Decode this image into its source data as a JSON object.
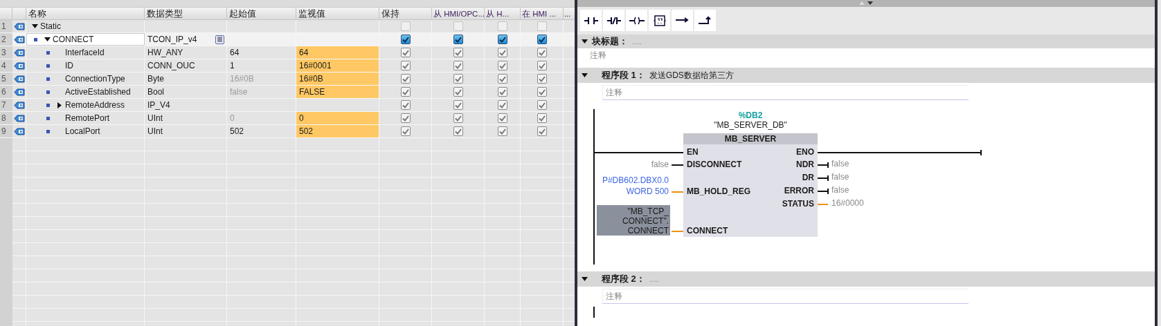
{
  "variable_table": {
    "columns": [
      {
        "label": "名称"
      },
      {
        "label": "数据类型"
      },
      {
        "label": "起始值"
      },
      {
        "label": "监视值"
      },
      {
        "label": "保持"
      },
      {
        "label": "从 HMI/OPC..."
      },
      {
        "label": "从 H..."
      },
      {
        "label": "在 HMI ..."
      },
      {
        "label": "..."
      }
    ],
    "rows": [
      {
        "number": "1",
        "name": "Static",
        "selected": false,
        "expanded": true,
        "flags": [
          {
            "checked": false,
            "disabled": true
          },
          {
            "checked": false,
            "disabled": true
          },
          {
            "checked": false,
            "disabled": true
          },
          {
            "checked": false,
            "disabled": true
          }
        ],
        "children": [
          {
            "number": "2",
            "name": "CONNECT",
            "type": "TCON_IP_v4",
            "selected": true,
            "expanded": true,
            "flags": [
              {
                "checked": true,
                "disabled": false
              },
              {
                "checked": true,
                "disabled": false
              },
              {
                "checked": true,
                "disabled": false
              },
              {
                "checked": true,
                "disabled": false
              }
            ],
            "children": [
              {
                "number": "3",
                "name": "InterfaceId",
                "type": "HW_ANY",
                "start": "64",
                "start_dimmed": false,
                "monitor": "64",
                "selected": false,
                "flags": [
                  {
                    "checked": true,
                    "disabled": true
                  },
                  {
                    "checked": true,
                    "disabled": true
                  },
                  {
                    "checked": true,
                    "disabled": true
                  },
                  {
                    "checked": true,
                    "disabled": true
                  }
                ]
              },
              {
                "number": "4",
                "name": "ID",
                "type": "CONN_OUC",
                "start": "1",
                "start_dimmed": false,
                "monitor": "16#0001",
                "selected": false,
                "flags": [
                  {
                    "checked": true,
                    "disabled": true
                  },
                  {
                    "checked": true,
                    "disabled": true
                  },
                  {
                    "checked": true,
                    "disabled": true
                  },
                  {
                    "checked": true,
                    "disabled": true
                  }
                ]
              },
              {
                "number": "5",
                "name": "ConnectionType",
                "type": "Byte",
                "start": "16#0B",
                "start_dimmed": true,
                "monitor": "16#0B",
                "selected": false,
                "flags": [
                  {
                    "checked": true,
                    "disabled": true
                  },
                  {
                    "checked": true,
                    "disabled": true
                  },
                  {
                    "checked": true,
                    "disabled": true
                  },
                  {
                    "checked": true,
                    "disabled": true
                  }
                ]
              },
              {
                "number": "6",
                "name": "ActiveEstablished",
                "type": "Bool",
                "start": "false",
                "start_dimmed": true,
                "monitor": "FALSE",
                "selected": false,
                "flags": [
                  {
                    "checked": true,
                    "disabled": true
                  },
                  {
                    "checked": true,
                    "disabled": true
                  },
                  {
                    "checked": true,
                    "disabled": true
                  },
                  {
                    "checked": true,
                    "disabled": true
                  }
                ]
              },
              {
                "number": "7",
                "name": "RemoteAddress",
                "type": "IP_V4",
                "selected": false,
                "expanded": false,
                "flags": [
                  {
                    "checked": true,
                    "disabled": true
                  },
                  {
                    "checked": true,
                    "disabled": true
                  },
                  {
                    "checked": true,
                    "disabled": true
                  },
                  {
                    "checked": true,
                    "disabled": true
                  }
                ]
              },
              {
                "number": "8",
                "name": "RemotePort",
                "type": "UInt",
                "start": "0",
                "start_dimmed": true,
                "monitor": "0",
                "selected": false,
                "flags": [
                  {
                    "checked": true,
                    "disabled": true
                  },
                  {
                    "checked": true,
                    "disabled": true
                  },
                  {
                    "checked": true,
                    "disabled": true
                  },
                  {
                    "checked": true,
                    "disabled": true
                  }
                ]
              },
              {
                "number": "9",
                "name": "LocalPort",
                "type": "UInt",
                "start": "502",
                "start_dimmed": false,
                "monitor": "502",
                "selected": false,
                "flags": [
                  {
                    "checked": true,
                    "disabled": true
                  },
                  {
                    "checked": true,
                    "disabled": true
                  },
                  {
                    "checked": true,
                    "disabled": true
                  },
                  {
                    "checked": true,
                    "disabled": true
                  }
                ]
              }
            ]
          }
        ]
      }
    ]
  },
  "editor": {
    "toolbar": [
      {
        "kind": "no_contact"
      },
      {
        "kind": "nc_contact"
      },
      {
        "kind": "coil"
      },
      {
        "kind": "empty_box"
      },
      {
        "kind": "branch_open"
      },
      {
        "kind": "branch_close"
      }
    ],
    "block_title": {
      "label": "块标题：",
      "value": ".....",
      "comment": "注释",
      "expanded": true
    },
    "networks": [
      {
        "label": "程序段 1：",
        "title": "发送GDS数据给第三方",
        "comment": "注释",
        "expanded": true,
        "block": {
          "instance_address": "%DB2",
          "instance_name": "\"MB_SERVER_DB\"",
          "name": "MB_SERVER",
          "inputs": [
            {
              "pin": "EN",
              "kind": "rail"
            },
            {
              "pin": "DISCONNECT",
              "kind": "constant",
              "value": [
                "false"
              ]
            },
            {
              "pin": "MB_HOLD_REG",
              "kind": "pointer",
              "value": [
                "P#DB602.DBX0.0",
                "WORD 500"
              ]
            },
            {
              "pin": "CONNECT",
              "kind": "tag",
              "value": [
                "\"MB_TCP_",
                "CONNECT\".",
                "CONNECT"
              ]
            }
          ],
          "outputs": [
            {
              "pin": "ENO",
              "kind": "rail"
            },
            {
              "pin": "NDR",
              "kind": "bool",
              "value": "false"
            },
            {
              "pin": "DR",
              "kind": "bool",
              "value": "false"
            },
            {
              "pin": "ERROR",
              "kind": "bool",
              "value": "false"
            },
            {
              "pin": "STATUS",
              "kind": "data",
              "value": "16#0000"
            }
          ]
        }
      },
      {
        "label": "程序段 2：",
        "title": ".....",
        "comment": "注释",
        "expanded": true
      }
    ]
  }
}
